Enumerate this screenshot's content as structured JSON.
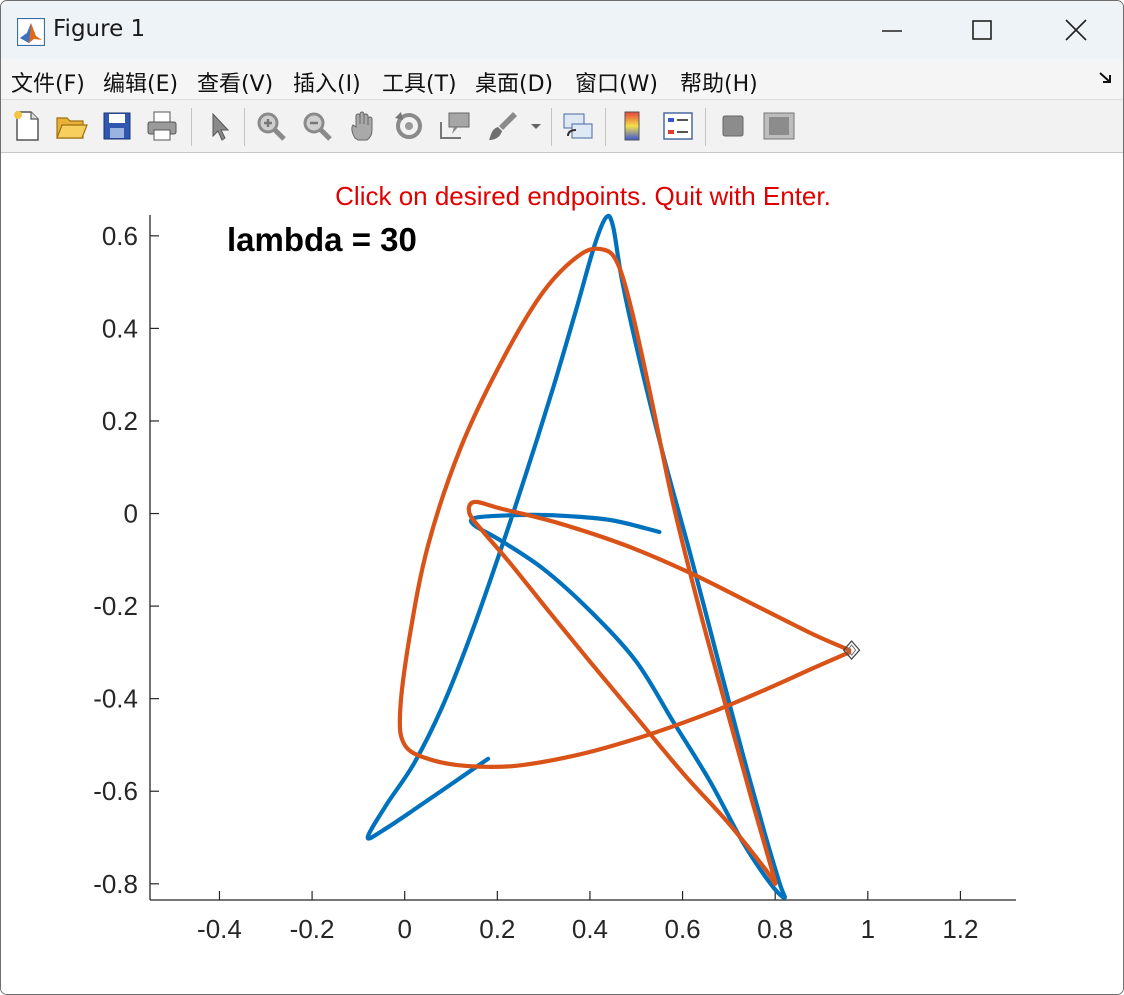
{
  "window": {
    "title": "Figure 1"
  },
  "menu": [
    "文件(F)",
    "编辑(E)",
    "查看(V)",
    "插入(I)",
    "工具(T)",
    "桌面(D)",
    "窗口(W)",
    "帮助(H)"
  ],
  "toolbar_icons": [
    "new-file-icon",
    "open-folder-icon",
    "save-icon",
    "print-icon",
    "pointer-icon",
    "zoom-in-icon",
    "zoom-out-icon",
    "pan-hand-icon",
    "rotate-icon",
    "data-cursor-icon",
    "brush-icon",
    "link-plot-icon",
    "colorbar-icon",
    "legend-icon",
    "hide-plot-tools-icon",
    "show-plot-tools-icon"
  ],
  "colors": {
    "blue": "#0072BD",
    "orange": "#D95319",
    "instruction": "#e00000"
  },
  "chart_data": {
    "type": "line",
    "instruction": "Click on desired endpoints. Quit with Enter.",
    "annotation": "lambda = 30",
    "xlim": [
      -0.55,
      1.32
    ],
    "ylim": [
      -0.835,
      0.645
    ],
    "xticks": [
      -0.4,
      -0.2,
      0,
      0.2,
      0.4,
      0.6,
      0.8,
      1,
      1.2
    ],
    "yticks": [
      0.6,
      0.4,
      0.2,
      0,
      -0.2,
      -0.4,
      -0.6,
      -0.8
    ],
    "xtick_labels": [
      "-0.4",
      "-0.2",
      "0",
      "0.2",
      "0.4",
      "0.6",
      "0.8",
      "1",
      "1.2"
    ],
    "ytick_labels": [
      "0.6",
      "0.4",
      "0.2",
      "0",
      "-0.2",
      "-0.4",
      "-0.6",
      "-0.8"
    ],
    "series": [
      {
        "color": "#0072BD",
        "points": [
          [
            0.18,
            -0.53
          ],
          [
            0.1,
            -0.585
          ],
          [
            0.02,
            -0.64
          ],
          [
            -0.04,
            -0.68
          ],
          [
            -0.08,
            -0.7
          ],
          [
            -0.04,
            -0.63
          ],
          [
            0.02,
            -0.54
          ],
          [
            0.08,
            -0.42
          ],
          [
            0.14,
            -0.27
          ],
          [
            0.2,
            -0.1
          ],
          [
            0.26,
            0.08
          ],
          [
            0.32,
            0.27
          ],
          [
            0.37,
            0.44
          ],
          [
            0.41,
            0.58
          ],
          [
            0.435,
            0.64
          ],
          [
            0.45,
            0.62
          ],
          [
            0.47,
            0.5
          ],
          [
            0.51,
            0.32
          ],
          [
            0.56,
            0.12
          ],
          [
            0.62,
            -0.1
          ],
          [
            0.68,
            -0.33
          ],
          [
            0.73,
            -0.52
          ],
          [
            0.78,
            -0.7
          ],
          [
            0.81,
            -0.8
          ],
          [
            0.82,
            -0.83
          ],
          [
            0.79,
            -0.8
          ],
          [
            0.73,
            -0.71
          ],
          [
            0.66,
            -0.58
          ],
          [
            0.58,
            -0.45
          ],
          [
            0.5,
            -0.32
          ],
          [
            0.4,
            -0.21
          ],
          [
            0.3,
            -0.12
          ],
          [
            0.21,
            -0.06
          ],
          [
            0.15,
            -0.025
          ],
          [
            0.15,
            -0.01
          ],
          [
            0.2,
            -0.005
          ],
          [
            0.28,
            -0.003
          ],
          [
            0.36,
            -0.006
          ],
          [
            0.45,
            -0.015
          ],
          [
            0.55,
            -0.04
          ]
        ]
      },
      {
        "color": "#D95319",
        "points": [
          [
            0.96,
            -0.295
          ],
          [
            0.88,
            -0.26
          ],
          [
            0.76,
            -0.2
          ],
          [
            0.62,
            -0.13
          ],
          [
            0.48,
            -0.07
          ],
          [
            0.33,
            -0.02
          ],
          [
            0.21,
            0.01
          ],
          [
            0.15,
            0.025
          ],
          [
            0.14,
            0.0
          ],
          [
            0.17,
            -0.04
          ],
          [
            0.23,
            -0.11
          ],
          [
            0.31,
            -0.21
          ],
          [
            0.4,
            -0.32
          ],
          [
            0.5,
            -0.44
          ],
          [
            0.6,
            -0.56
          ],
          [
            0.7,
            -0.67
          ],
          [
            0.78,
            -0.77
          ],
          [
            0.8,
            -0.8
          ],
          [
            0.79,
            -0.76
          ],
          [
            0.75,
            -0.62
          ],
          [
            0.7,
            -0.44
          ],
          [
            0.64,
            -0.22
          ],
          [
            0.58,
            0.02
          ],
          [
            0.53,
            0.26
          ],
          [
            0.49,
            0.44
          ],
          [
            0.46,
            0.54
          ],
          [
            0.43,
            0.57
          ],
          [
            0.38,
            0.56
          ],
          [
            0.3,
            0.48
          ],
          [
            0.21,
            0.33
          ],
          [
            0.12,
            0.14
          ],
          [
            0.05,
            -0.07
          ],
          [
            0.01,
            -0.27
          ],
          [
            -0.01,
            -0.43
          ],
          [
            0.0,
            -0.5
          ],
          [
            0.05,
            -0.53
          ],
          [
            0.13,
            -0.545
          ],
          [
            0.24,
            -0.545
          ],
          [
            0.38,
            -0.52
          ],
          [
            0.52,
            -0.48
          ],
          [
            0.66,
            -0.43
          ],
          [
            0.78,
            -0.38
          ],
          [
            0.88,
            -0.335
          ],
          [
            0.96,
            -0.3
          ]
        ]
      }
    ]
  }
}
